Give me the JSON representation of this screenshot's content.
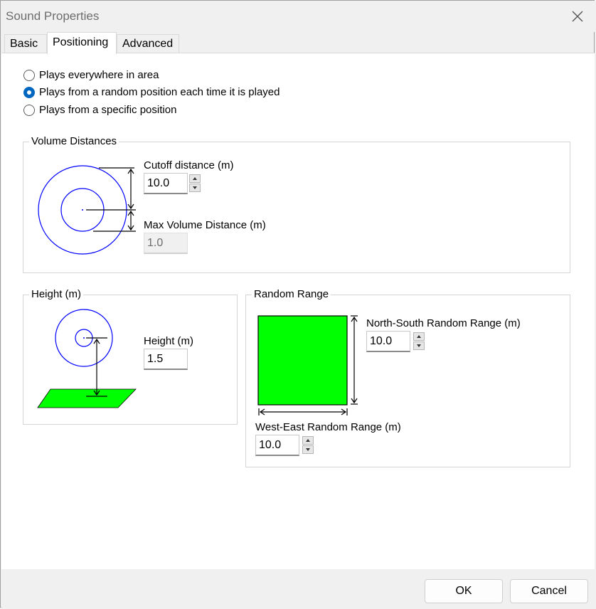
{
  "window": {
    "title": "Sound Properties"
  },
  "tabs": [
    {
      "label": "Basic"
    },
    {
      "label": "Positioning"
    },
    {
      "label": "Advanced"
    }
  ],
  "positioning": {
    "mode_options": [
      {
        "label": "Plays everywhere in area",
        "checked": false
      },
      {
        "label": "Plays from a random position each time it is played",
        "checked": true
      },
      {
        "label": "Plays from a specific position",
        "checked": false
      }
    ],
    "volume_distances": {
      "title": "Volume Distances",
      "cutoff_label": "Cutoff distance (m)",
      "cutoff_value": "10.0",
      "max_volume_label": "Max Volume Distance (m)",
      "max_volume_value": "1.0"
    },
    "height": {
      "title": "Height (m)",
      "height_label": "Height (m)",
      "height_value": "1.5"
    },
    "random_range": {
      "title": "Random Range",
      "ns_label": "North-South Random Range (m)",
      "ns_value": "10.0",
      "we_label": "West-East Random Range (m)",
      "we_value": "10.0"
    }
  },
  "buttons": {
    "ok": "OK",
    "cancel": "Cancel"
  },
  "colors": {
    "accent": "#0067c0",
    "diagram_blue": "#0000ff",
    "diagram_green": "#00ff00"
  },
  "icons": {
    "close": "close-icon",
    "spin_up": "arrow-up-icon",
    "spin_down": "arrow-down-icon"
  }
}
